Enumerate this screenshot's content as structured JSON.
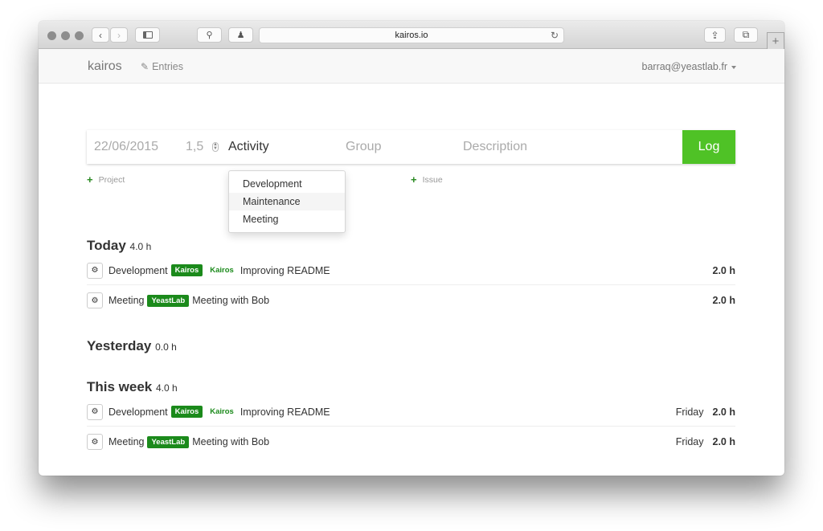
{
  "browser": {
    "url": "kairos.io",
    "icons": [
      "back-icon",
      "forward-icon",
      "sidebar-icon",
      "search-icon",
      "ghostery-icon",
      "reload-icon",
      "share-icon",
      "tabs-icon",
      "new-tab-icon"
    ]
  },
  "navbar": {
    "brand": "kairos",
    "entries_label": "Entries",
    "user": "barraq@yeastlab.fr"
  },
  "form": {
    "date": "22/06/2015",
    "duration": "1,5",
    "activity": "Activity",
    "group_placeholder": "Group",
    "description_placeholder": "Description",
    "log_label": "Log",
    "add_project": "Project",
    "add_issue": "Issue"
  },
  "activity_dropdown": {
    "options": [
      "Development",
      "Maintenance",
      "Meeting"
    ],
    "highlighted": "Maintenance"
  },
  "sections": [
    {
      "title": "Today",
      "hours": "4.0 h",
      "entries": [
        {
          "activity": "Development",
          "badge": "Kairos",
          "group": "Kairos",
          "description": "Improving README",
          "day": "",
          "duration": "2.0 h"
        },
        {
          "activity": "Meeting",
          "badge": "YeastLab",
          "group": "",
          "description": "Meeting with Bob",
          "day": "",
          "duration": "2.0 h"
        }
      ]
    },
    {
      "title": "Yesterday",
      "hours": "0.0 h",
      "entries": []
    },
    {
      "title": "This week",
      "hours": "4.0 h",
      "entries": [
        {
          "activity": "Development",
          "badge": "Kairos",
          "group": "Kairos",
          "description": "Improving README",
          "day": "Friday",
          "duration": "2.0 h"
        },
        {
          "activity": "Meeting",
          "badge": "YeastLab",
          "group": "",
          "description": "Meeting with Bob",
          "day": "Friday",
          "duration": "2.0 h"
        }
      ]
    }
  ],
  "colors": {
    "log_button": "#4fc226",
    "badge": "#1b8a1b"
  }
}
